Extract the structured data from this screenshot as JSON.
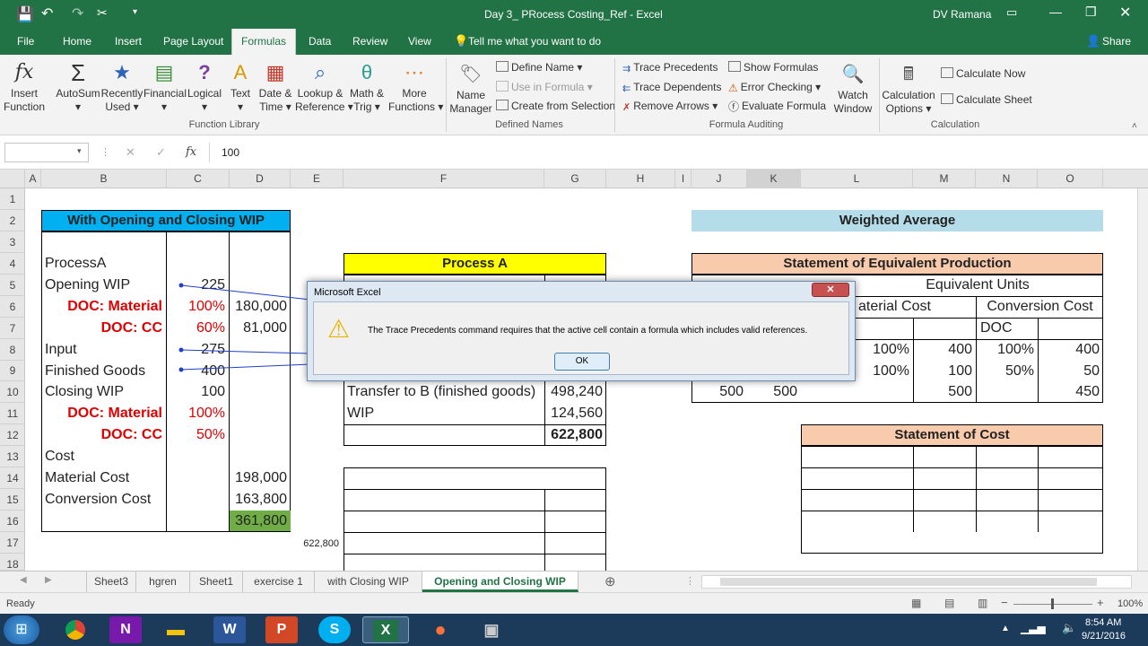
{
  "window": {
    "title": "Day 3_ PRocess Costing_Ref  -  Excel",
    "user": "DV Ramana"
  },
  "menu": {
    "tabs": [
      "File",
      "Home",
      "Insert",
      "Page Layout",
      "Formulas",
      "Data",
      "Review",
      "View"
    ],
    "tell_me": "Tell me what you want to do",
    "share": "Share"
  },
  "ribbon": {
    "function_library": {
      "label": "Function Library",
      "buttons": [
        {
          "l1": "Insert",
          "l2": "Function",
          "icon": "fx"
        },
        {
          "l1": "AutoSum",
          "l2": "▾",
          "icon": "Σ"
        },
        {
          "l1": "Recently",
          "l2": "Used ▾",
          "icon": "★"
        },
        {
          "l1": "Financial",
          "l2": "▾",
          "icon": "▤"
        },
        {
          "l1": "Logical",
          "l2": "▾",
          "icon": "?"
        },
        {
          "l1": "Text",
          "l2": "▾",
          "icon": "A"
        },
        {
          "l1": "Date &",
          "l2": "Time ▾",
          "icon": "▦"
        },
        {
          "l1": "Lookup &",
          "l2": "Reference ▾",
          "icon": "⌕"
        },
        {
          "l1": "Math &",
          "l2": "Trig ▾",
          "icon": "θ"
        },
        {
          "l1": "More",
          "l2": "Functions ▾",
          "icon": "⋯"
        }
      ]
    },
    "defined_names": {
      "label": "Defined Names",
      "name_manager_l1": "Name",
      "name_manager_l2": "Manager",
      "define_name": "Define Name ▾",
      "use_in_formula": "Use in Formula ▾",
      "create_from_selection": "Create from Selection"
    },
    "formula_auditing": {
      "label": "Formula Auditing",
      "trace_precedents": "Trace Precedents",
      "trace_dependents": "Trace Dependents",
      "remove_arrows": "Remove Arrows ▾",
      "show_formulas": "Show Formulas",
      "error_checking": "Error Checking ▾",
      "evaluate_formula": "Evaluate Formula",
      "watch_l1": "Watch",
      "watch_l2": "Window"
    },
    "calculation": {
      "label": "Calculation",
      "options_l1": "Calculation",
      "options_l2": "Options ▾",
      "calc_now": "Calculate Now",
      "calc_sheet": "Calculate Sheet"
    }
  },
  "formula_bar": {
    "name_box": "",
    "fx": "fx",
    "value": "100"
  },
  "columns": [
    "A",
    "B",
    "C",
    "D",
    "E",
    "F",
    "G",
    "H",
    "I",
    "J",
    "K",
    "L",
    "M",
    "N",
    "O"
  ],
  "rows": [
    "1",
    "2",
    "3",
    "4",
    "5",
    "6",
    "7",
    "8",
    "9",
    "10",
    "11",
    "12",
    "13",
    "14",
    "15",
    "16",
    "17",
    "18"
  ],
  "left_table": {
    "title": "With Opening and Closing WIP",
    "process": "ProcessA",
    "opening_wip": "Opening WIP",
    "opening_wip_val": "225",
    "doc_material": "DOC: Material",
    "doc_material_pct": "100%",
    "doc_material_amt": "180,000",
    "doc_cc": "DOC: CC",
    "doc_cc_pct": "60%",
    "doc_cc_amt": "81,000",
    "input": "Input",
    "input_val": "275",
    "finished_goods": "Finished Goods",
    "finished_goods_val": "400",
    "closing_wip": "Closing WIP",
    "closing_wip_val": "100",
    "doc_material2": "DOC: Material",
    "doc_material2_pct": "100%",
    "doc_cc2": "DOC: CC",
    "doc_cc2_pct": "50%",
    "cost": "Cost",
    "material_cost": "Material Cost",
    "material_cost_val": "198,000",
    "conversion_cost": "Conversion Cost",
    "conversion_cost_val": "163,800",
    "total": "361,800"
  },
  "process_a": {
    "title": "Process A",
    "transfer": "Transfer to B (finished goods)",
    "transfer_val": "498,240",
    "wip": "WIP",
    "wip_val": "124,560",
    "total": "622,800"
  },
  "e17": "622,800",
  "weighted": {
    "title": "Weighted Average",
    "sep_title": "Statement of Equivalent Production",
    "equiv_units": "Equivalent Units",
    "material_cost": "aterial Cost",
    "conversion_cost": "Conversion Cost",
    "doc": "DOC",
    "r8": [
      "100%",
      "400",
      "100%",
      "400"
    ],
    "r9": [
      "100%",
      "100",
      "50%",
      "50"
    ],
    "r10": [
      "500",
      "500",
      "500",
      "450"
    ],
    "soc_title": "Statement of Cost"
  },
  "sheets": [
    "Sheet3",
    "hgren",
    "Sheet1",
    "exercise 1",
    "with Closing WIP",
    "Opening and Closing WIP"
  ],
  "status": {
    "ready": "Ready",
    "zoom": "100%"
  },
  "dialog": {
    "title": "Microsoft Excel",
    "message": "The Trace Precedents command requires that the active cell contain a formula which includes valid references.",
    "ok": "OK"
  },
  "taskbar": {
    "time": "8:54 AM",
    "date": "9/21/2016"
  },
  "colors": {
    "excel_green": "#217346",
    "blue_header": "#00b0f0",
    "yellow": "#ffff00",
    "peach": "#f8cbad",
    "light_blue": "#b4dde9",
    "green_cell": "#70ad47",
    "red_text": "#e00000"
  }
}
